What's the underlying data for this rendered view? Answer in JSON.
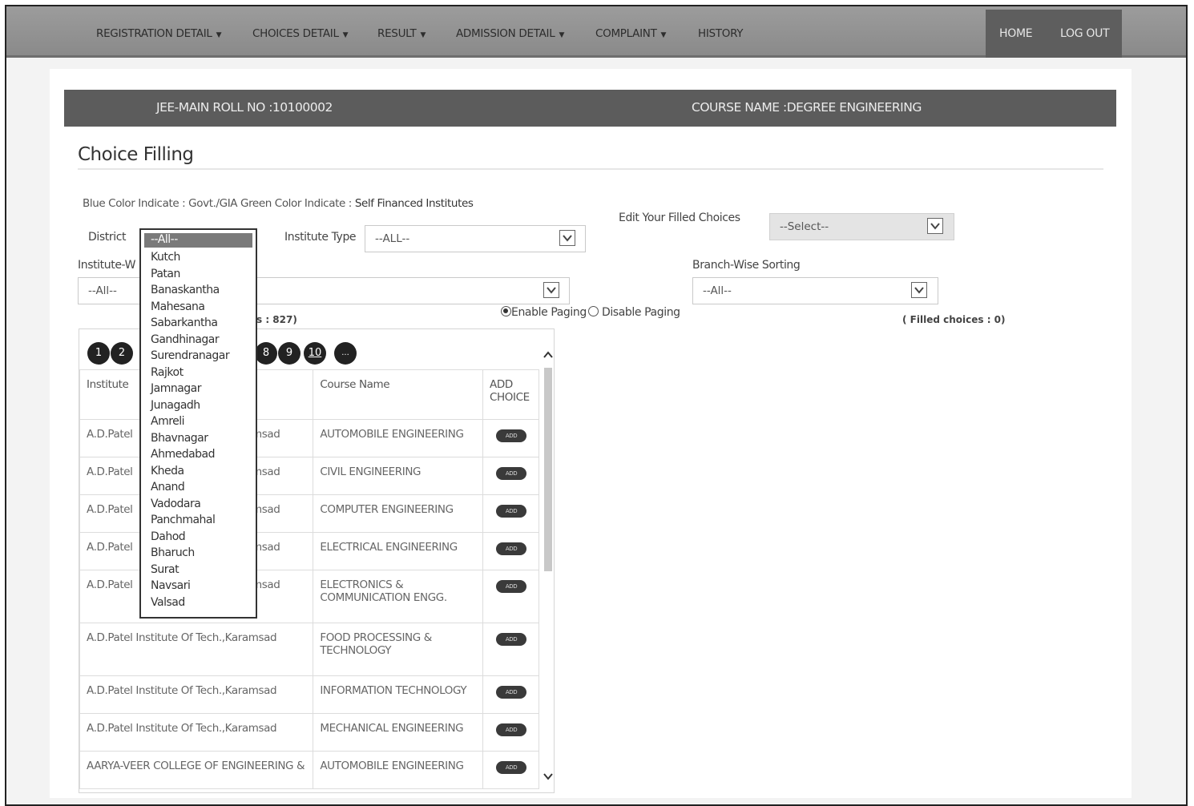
{
  "nav": {
    "items": [
      {
        "label": "REGISTRATION DETAIL",
        "dropdown": true
      },
      {
        "label": "CHOICES DETAIL",
        "dropdown": true
      },
      {
        "label": "RESULT",
        "dropdown": true
      },
      {
        "label": "ADMISSION DETAIL",
        "dropdown": true
      },
      {
        "label": "COMPLAINT",
        "dropdown": true
      },
      {
        "label": "HISTORY",
        "dropdown": false
      }
    ],
    "home": "HOME",
    "logout": "LOG OUT"
  },
  "info": {
    "roll": "JEE-MAIN ROLL NO :10100002",
    "course": "COURSE NAME :DEGREE ENGINEERING"
  },
  "page": {
    "title": "Choice Filling",
    "legend_blue": "Blue Color Indicate : Govt./GIA",
    "legend_green": "Green Color Indicate :",
    "legend_self": "Self Financed Institutes"
  },
  "filters": {
    "district_label": "District",
    "district_value": "--All--",
    "institute_type_label": "Institute Type",
    "institute_type_value": "--ALL--",
    "institute_wise_label": "Institute-W",
    "institute_wise_value": "--All--",
    "edit_filled_label": "Edit Your Filled Choices",
    "edit_filled_value": "--Select--",
    "branch_sort_label": "Branch-Wise Sorting",
    "branch_sort_value": "--All--",
    "enable_paging": "Enable Paging",
    "disable_paging": "Disable Paging",
    "records_partial": "s : 827)",
    "filled_choices": "( Filled choices : 0)"
  },
  "pager": [
    "1",
    "2",
    "8",
    "9",
    "10",
    "..."
  ],
  "table": {
    "headers": {
      "institute": "Institute",
      "course": "Course Name",
      "add1": "ADD",
      "add2": "CHOICE"
    },
    "add_label": "ADD",
    "rows": [
      {
        "institute": "A.D.Patel",
        "suffix": "msad",
        "course": "AUTOMOBILE ENGINEERING",
        "course2": ""
      },
      {
        "institute": "A.D.Patel",
        "suffix": "msad",
        "course": "CIVIL ENGINEERING",
        "course2": ""
      },
      {
        "institute": "A.D.Patel",
        "suffix": "msad",
        "course": "COMPUTER ENGINEERING",
        "course2": ""
      },
      {
        "institute": "A.D.Patel",
        "suffix": "msad",
        "course": "ELECTRICAL ENGINEERING",
        "course2": ""
      },
      {
        "institute": "A.D.Patel",
        "suffix": "msad",
        "course": "ELECTRONICS &",
        "course2": "COMMUNICATION ENGG."
      },
      {
        "institute": "A.D.Patel Institute Of Tech.,Karamsad",
        "suffix": "",
        "course": "FOOD PROCESSING &",
        "course2": "TECHNOLOGY"
      },
      {
        "institute": "A.D.Patel Institute Of Tech.,Karamsad",
        "suffix": "",
        "course": "INFORMATION TECHNOLOGY",
        "course2": ""
      },
      {
        "institute": "A.D.Patel Institute Of Tech.,Karamsad",
        "suffix": "",
        "course": "MECHANICAL ENGINEERING",
        "course2": ""
      },
      {
        "institute": "AARYA-VEER COLLEGE OF ENGINEERING &",
        "suffix": "",
        "course": "AUTOMOBILE ENGINEERING",
        "course2": ""
      }
    ]
  },
  "district_options": [
    "--All--",
    "Kutch",
    "Patan",
    "Banaskantha",
    "Mahesana",
    "Sabarkantha",
    "Gandhinagar",
    "Surendranagar",
    "Rajkot",
    "Jamnagar",
    "Junagadh",
    "Amreli",
    "Bhavnagar",
    "Ahmedabad",
    "Kheda",
    "Anand",
    "Vadodara",
    "Panchmahal",
    "Dahod",
    "Bharuch",
    "Surat",
    "Navsari",
    "Valsad"
  ],
  "colors": {
    "topbar": "#8f8f8f",
    "infobar": "#5c5c5c",
    "button_dark": "#222222"
  },
  "icons": {
    "caret": "caret-down-icon",
    "chevron": "chevron-down-icon",
    "scroll_up": "chevron-up-icon",
    "scroll_down": "chevron-down-icon"
  }
}
